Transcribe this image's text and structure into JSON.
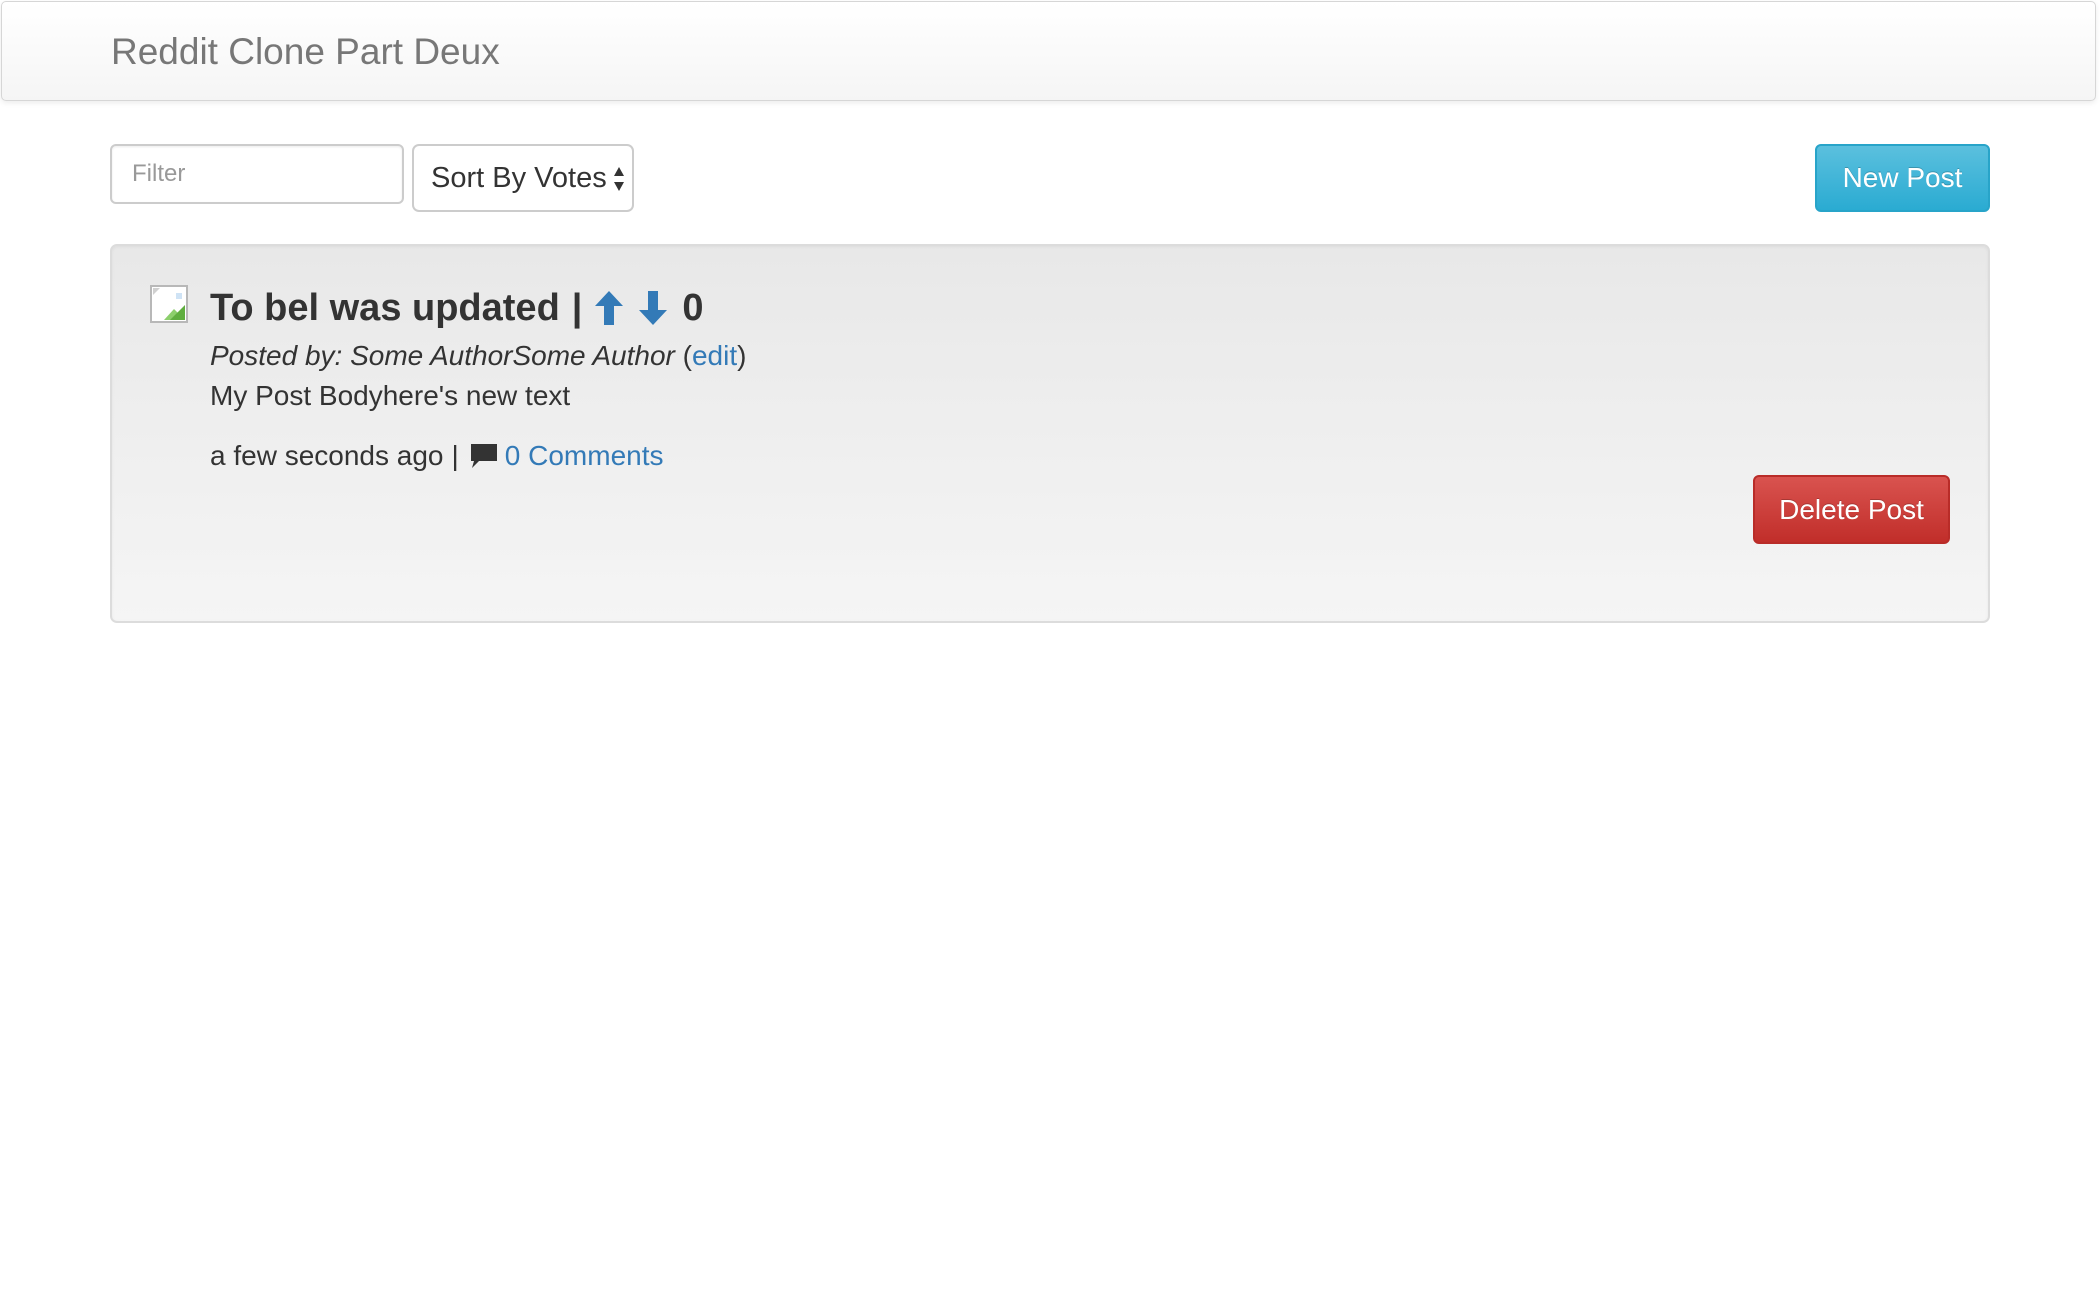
{
  "navbar": {
    "brand": "Reddit Clone Part Deux"
  },
  "toolbar": {
    "filter_placeholder": "Filter",
    "filter_value": "",
    "sort_selected": "Sort By Votes",
    "new_post_label": "New Post"
  },
  "post": {
    "image_icon": "broken-image-icon",
    "title": "To bel was updated",
    "separator": "|",
    "vote_count": "0",
    "upvote_icon": "arrow-up-icon",
    "downvote_icon": "arrow-down-icon",
    "posted_by_label": "Posted by: Some AuthorSome Author",
    "edit_open": "(",
    "edit_label": "edit",
    "edit_close": ")",
    "body": "My Post Bodyhere's new text",
    "timestamp": "a few seconds ago",
    "footer_separator": "|",
    "comments_icon": "comment-icon",
    "comments_label": "0 Comments",
    "delete_label": "Delete Post"
  },
  "colors": {
    "link": "#337ab7",
    "info_button": "#31b0d5",
    "danger_button": "#c9302c",
    "card_bg": "#eeeeee"
  }
}
